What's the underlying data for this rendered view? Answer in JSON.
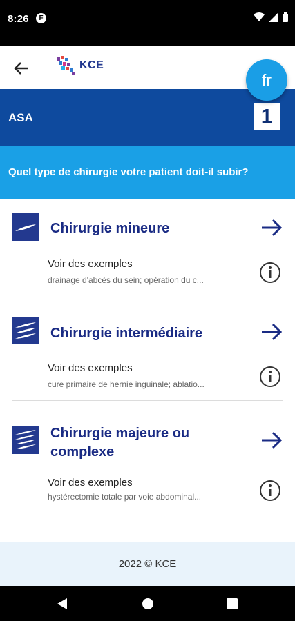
{
  "status_bar": {
    "time": "8:26",
    "notification_glyph": "F"
  },
  "app_bar": {
    "logo_text": "KCE",
    "back_icon": "arrow-left-icon"
  },
  "language_button": {
    "label": "fr"
  },
  "asa": {
    "label": "ASA",
    "value": "1"
  },
  "question": "Quel type de chirurgie votre patient doit-il subir?",
  "options": [
    {
      "title": "Chirurgie mineure",
      "examples_label": "Voir des exemples",
      "examples_text": "drainage d'abcès du sein; opération du c..."
    },
    {
      "title": "Chirurgie intermédiaire",
      "examples_label": "Voir des exemples",
      "examples_text": "cure primaire de hernie inguinale; ablatio..."
    },
    {
      "title": "Chirurgie majeure ou complexe",
      "examples_label": "Voir des exemples",
      "examples_text": "hystérectomie totale par voie abdominal..."
    }
  ],
  "footer": {
    "text": "2022 © KCE"
  },
  "colors": {
    "dark_blue": "#0e4a9e",
    "light_blue": "#1aa0e6",
    "navy": "#23398f",
    "footer_bg": "#e9f3fb"
  }
}
